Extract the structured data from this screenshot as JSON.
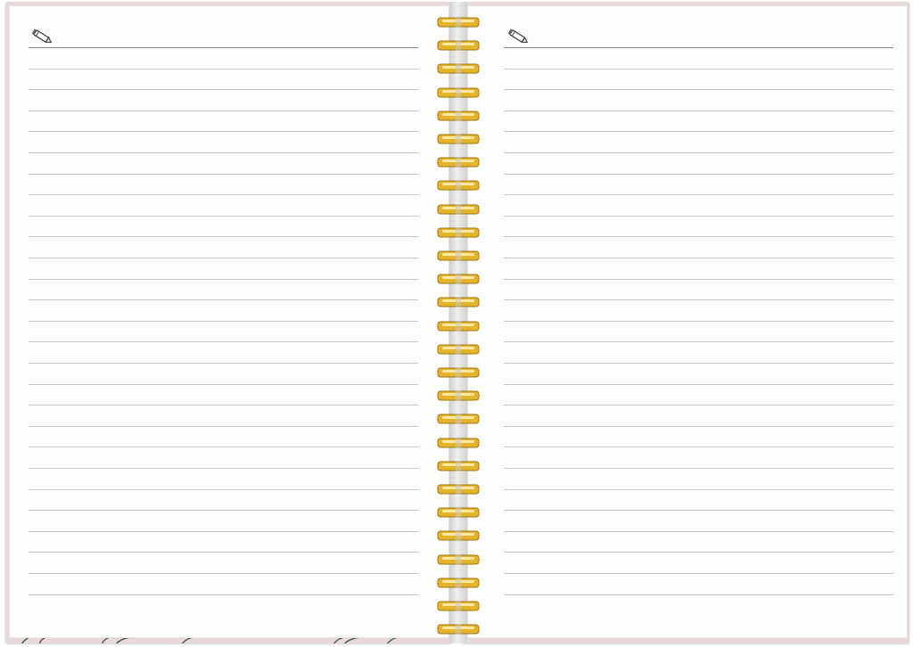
{
  "notebook": {
    "pages": [
      {
        "side": "left",
        "header_icon": "pencil-icon",
        "ruled_line_count": 27
      },
      {
        "side": "right",
        "header_icon": "pencil-icon",
        "ruled_line_count": 27
      }
    ],
    "binding": {
      "type": "spiral",
      "coil_count": 27
    },
    "colors": {
      "paper": "#fdfdfb",
      "cover": "#e8d8d7",
      "rule": "#c8c8c6",
      "header_rule": "#8a8a88",
      "coil_gold": "#e6b42a",
      "cover_leaf": "#3f5b47"
    }
  }
}
